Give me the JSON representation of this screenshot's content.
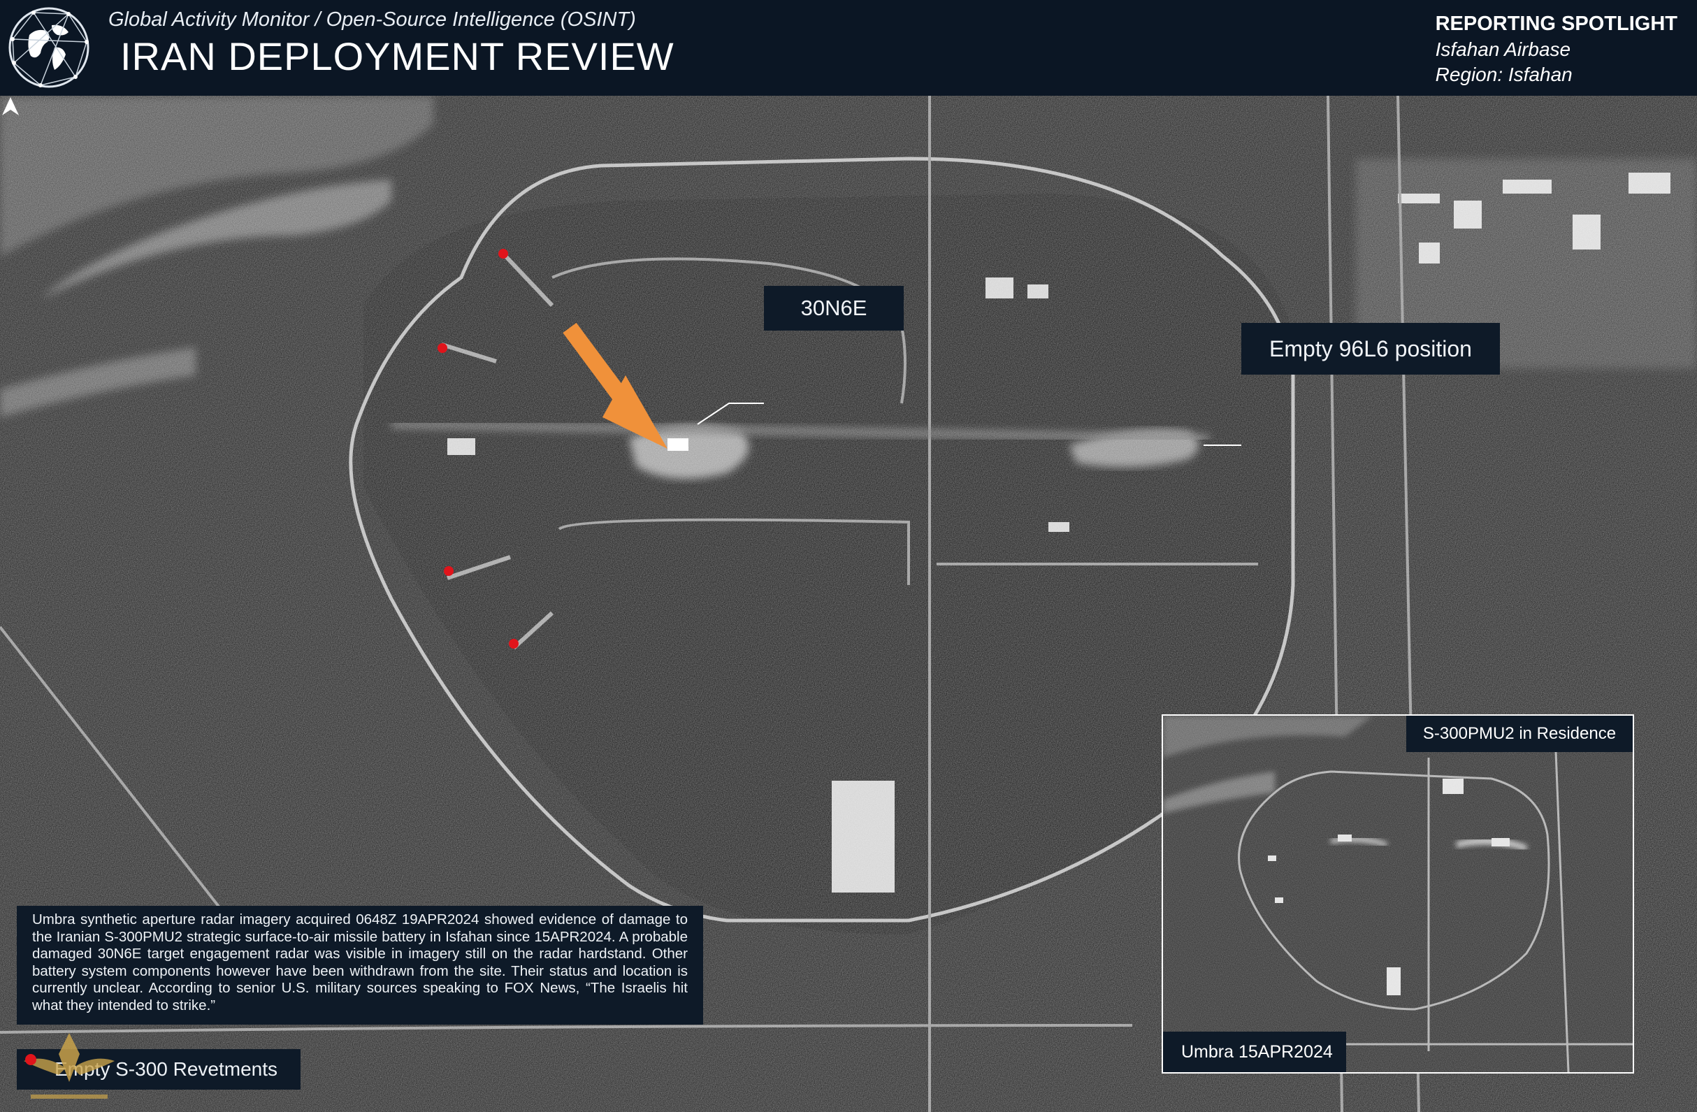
{
  "header": {
    "subtitle": "Global Activity Monitor  /  Open-Source Intelligence (OSINT)",
    "title": "IRAN DEPLOYMENT REVIEW",
    "spotlight_heading": "REPORTING SPOTLIGHT",
    "spotlight_site": "Isfahan Airbase",
    "spotlight_region": "Region: Isfahan"
  },
  "annotations": {
    "radar_label": "30N6E",
    "empty_position_label": "Empty 96L6 position",
    "revetments_label": "Empty S-300 Revetments"
  },
  "caption": "Umbra synthetic aperture radar imagery acquired 0648Z 19APR2024 showed evidence of damage to the Iranian S-300PMU2 strategic surface-to-air missile battery in Isfahan since 15APR2024.  A probable damaged 30N6E target engagement radar was visible in imagery still on the radar hardstand. Other battery system components however have been withdrawn from the site. Their status and location is currently unclear. According to senior U.S. military sources speaking to FOX News, “The Israelis hit what they intended to strike.”",
  "inset": {
    "title": "S-300PMU2 in Residence",
    "date_label": "Umbra 15APR2024"
  },
  "icons": {
    "logo": "globe-network-icon",
    "north": "north-arrow-icon",
    "forum": "eagle-emblem-icon"
  },
  "colors": {
    "arrow": "#f0913a",
    "marker": "#e0141b",
    "label_bg": "#0e1a28",
    "header_bg": "#0b1624"
  }
}
